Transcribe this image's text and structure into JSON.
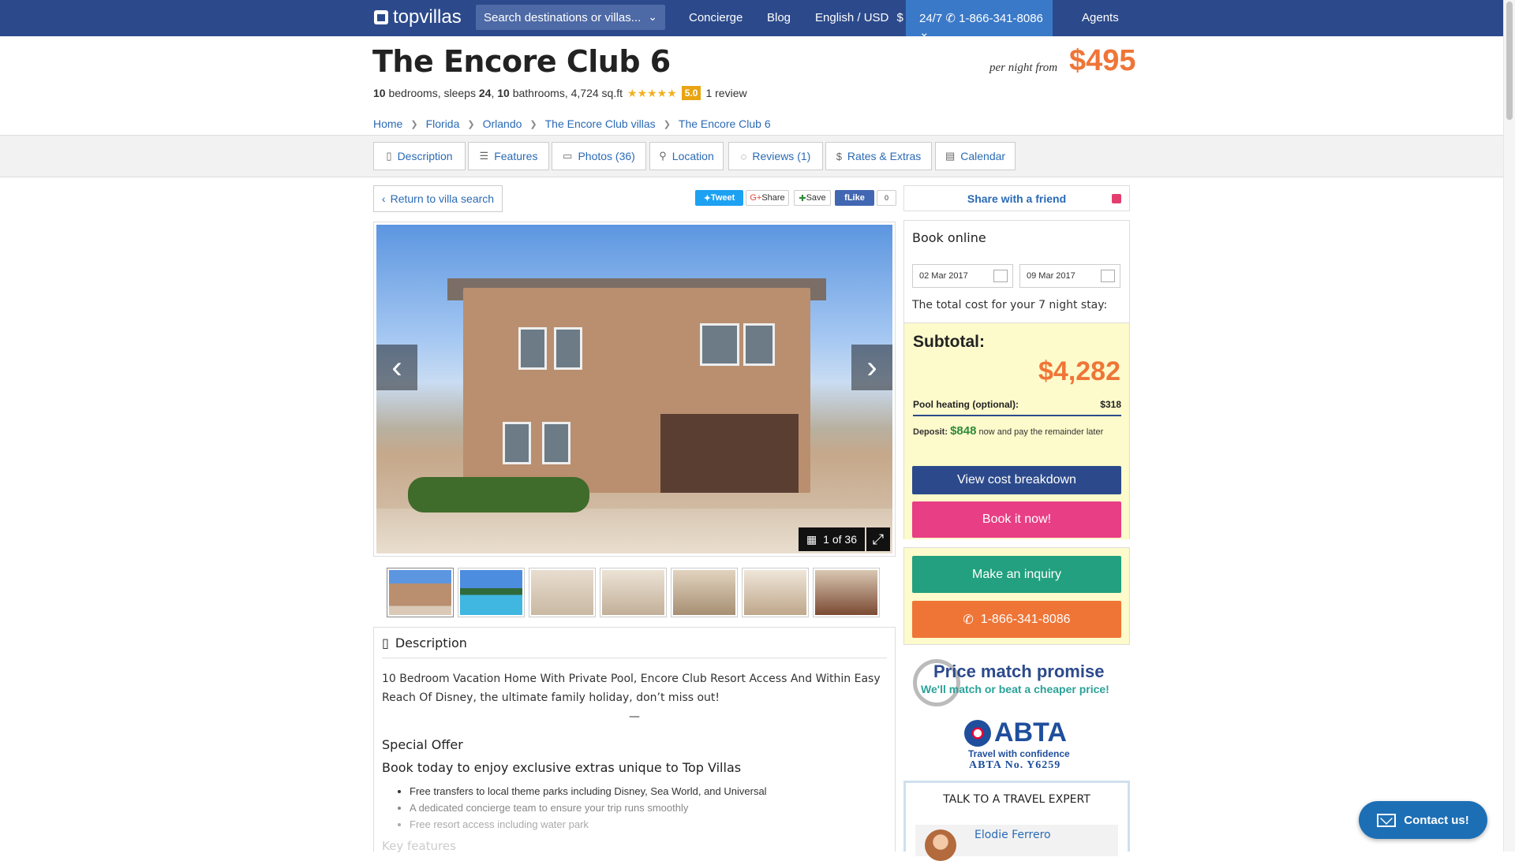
{
  "nav": {
    "logo": "topvillas",
    "search_placeholder": "Search destinations or villas...",
    "concierge": "Concierge",
    "blog": "Blog",
    "currency": "English / USD",
    "currency_symbol": "$",
    "hours": "24/7",
    "phone": "1-866-341-8086",
    "agents": "Agents"
  },
  "villa": {
    "title": "The Encore Club 6",
    "bedrooms": "10",
    "bedrooms_label": "bedrooms, sleeps",
    "sleeps": "24",
    "bathrooms": "10",
    "bathrooms_label": "bathrooms, 4,724 sq.ft",
    "rating": "5.0",
    "reviews": "1 review",
    "price_label": "per night from",
    "price": "$495"
  },
  "breadcrumb": [
    "Home",
    "Florida",
    "Orlando",
    "The Encore Club villas",
    "The Encore Club 6"
  ],
  "tabs": [
    "Description",
    "Features",
    "Photos (36)",
    "Location",
    "Reviews (1)",
    "Rates & Extras",
    "Calendar"
  ],
  "return_label": "Return to villa search",
  "social": {
    "tweet": "Tweet",
    "share": "Share",
    "save": "Save",
    "like": "Like",
    "like_count": "0"
  },
  "share_friend": "Share with a friend",
  "gallery": {
    "counter": "1 of 36"
  },
  "booking": {
    "title": "Book online",
    "checkin": "02 Mar 2017",
    "checkout": "09 Mar 2017",
    "total_text": "The total cost for your 7 night stay:",
    "subtotal_label": "Subtotal:",
    "subtotal": "$4,282",
    "pool_label": "Pool heating (optional):",
    "pool_price": "$318",
    "deposit_label": "Deposit:",
    "deposit_amount": "$848",
    "deposit_text": "now and pay the remainder later",
    "breakdown": "View cost breakdown",
    "book_now": "Book it now!",
    "inquiry": "Make an inquiry",
    "phone": "1-866-341-8086"
  },
  "price_match": {
    "title": "Price match promise",
    "subtitle": "We'll match or beat a cheaper price!"
  },
  "abta": {
    "logo": "ABTA",
    "tagline": "Travel with confidence",
    "number": "ABTA No. Y6259"
  },
  "expert": {
    "title": "TALK TO A TRAVEL EXPERT",
    "name": "Elodie Ferrero"
  },
  "description": {
    "heading": "Description",
    "intro": "10 Bedroom Vacation Home With Private Pool, Encore Club Resort Access And Within Easy Reach Of Disney, the ultimate family holiday, don’t miss out!",
    "dash": "—",
    "offer_heading": "Special Offer",
    "offer_sub": "Book today to enjoy exclusive extras unique to Top Villas",
    "bullets": [
      "Free transfers to local theme parks including Disney, Sea World, and Universal",
      "A dedicated concierge team to ensure your trip runs smoothly",
      "Free resort access including water park"
    ],
    "key_features": "Key features"
  },
  "contact_us": "Contact us!",
  "colors": {
    "nav": "#2c4a8b",
    "accent_orange": "#ef7537",
    "book_pink": "#e83e85",
    "inquiry_green": "#22a07f"
  }
}
